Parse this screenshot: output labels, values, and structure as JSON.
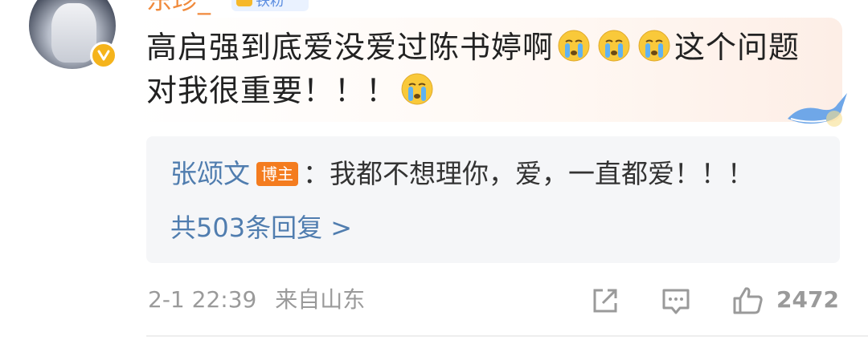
{
  "comment": {
    "username": "东珍_",
    "fan_badge": "铁粉",
    "text_part1": "高启强到底爱没爱过陈书婷啊",
    "text_part2": "这个问题对我很重要！！！",
    "emoji_name": "crying-emoji"
  },
  "reply": {
    "author": "张颂文",
    "host_badge": "博主",
    "separator": "：",
    "text": "我都不想理你，爱，一直都爱！！！",
    "more_label": "共503条回复 >"
  },
  "footer": {
    "datetime": "2-1 22:39",
    "location": "来自山东",
    "like_count": "2472"
  },
  "colors": {
    "username": "#f08a3c",
    "link": "#507daf",
    "host_badge_bg": "#f47c1f",
    "meta": "#9a9a9a",
    "verify_badge": "#f5b41c"
  }
}
